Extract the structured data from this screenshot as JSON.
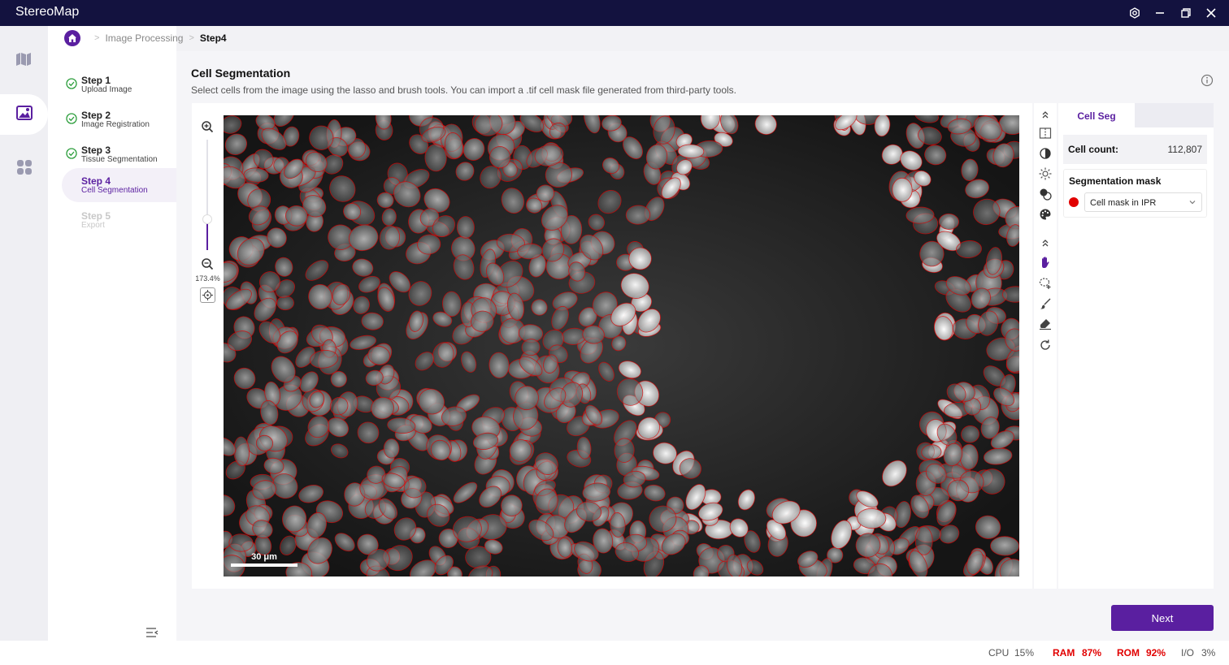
{
  "app": {
    "title": "StereoMap"
  },
  "breadcrumb": {
    "items": [
      "Image Processing",
      "Step4"
    ]
  },
  "steps": [
    {
      "title": "Step 1",
      "subtitle": "Upload Image",
      "state": "done"
    },
    {
      "title": "Step 2",
      "subtitle": "Image Registration",
      "state": "done"
    },
    {
      "title": "Step 3",
      "subtitle": "Tissue Segmentation",
      "state": "done"
    },
    {
      "title": "Step 4",
      "subtitle": "Cell Segmentation",
      "state": "active"
    },
    {
      "title": "Step 5",
      "subtitle": "Export",
      "state": "disabled"
    }
  ],
  "section": {
    "title": "Cell Segmentation",
    "description": "Select cells from the image using the lasso and brush tools. You can import a .tif cell mask file generated from third-party tools."
  },
  "viewer": {
    "zoom_label": "173.4%",
    "zoom_slider_fraction": 0.28,
    "scale_bar_label": "30 μm"
  },
  "panel": {
    "tab_label": "Cell Seg",
    "cell_count_label": "Cell count:",
    "cell_count_value": "112,807",
    "mask_section_title": "Segmentation mask",
    "mask_selected": "Cell mask in IPR",
    "mask_color": "#e10000"
  },
  "actions": {
    "next_label": "Next"
  },
  "status": {
    "cpu_label": "CPU",
    "cpu_value": "15%",
    "ram_label": "RAM",
    "ram_value": "87%",
    "rom_label": "ROM",
    "rom_value": "92%",
    "io_label": "I/O",
    "io_value": "3%"
  },
  "colors": {
    "brand": "#5a1fa0",
    "titlebar": "#13123f",
    "warning": "#e10000",
    "done": "#2a9d3a"
  }
}
